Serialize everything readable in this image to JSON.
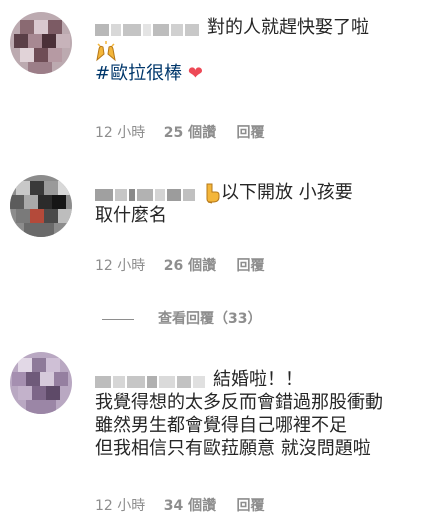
{
  "comments": [
    {
      "text": "對的人就趕快娶了啦",
      "hashtag": "#歐拉很棒",
      "time": "12 小時",
      "likes": "25 個讚",
      "reply": "回覆"
    },
    {
      "text_a": "以下開放 小孩要",
      "text_b": "取什麼名",
      "time": "12 小時",
      "likes": "26 個讚",
      "reply": "回覆"
    },
    {
      "line1": "結婚啦！！",
      "line2": "我覺得想的太多反而會錯過那股衝動",
      "line3": "雖然男生都會覺得自己哪裡不足",
      "line4": "但我相信只有歐菈願意 就沒問題啦",
      "time": "12 小時",
      "likes": "34 個讚",
      "reply": "回覆"
    }
  ],
  "view_replies": "查看回覆（33）",
  "colors": {
    "text": "#262626",
    "meta": "#8e8e8e",
    "hashtag": "#00376b",
    "heart": "#ed4956"
  },
  "icons": [
    "raising-hands-emoji",
    "red-heart-emoji",
    "pointing-down-emoji"
  ]
}
